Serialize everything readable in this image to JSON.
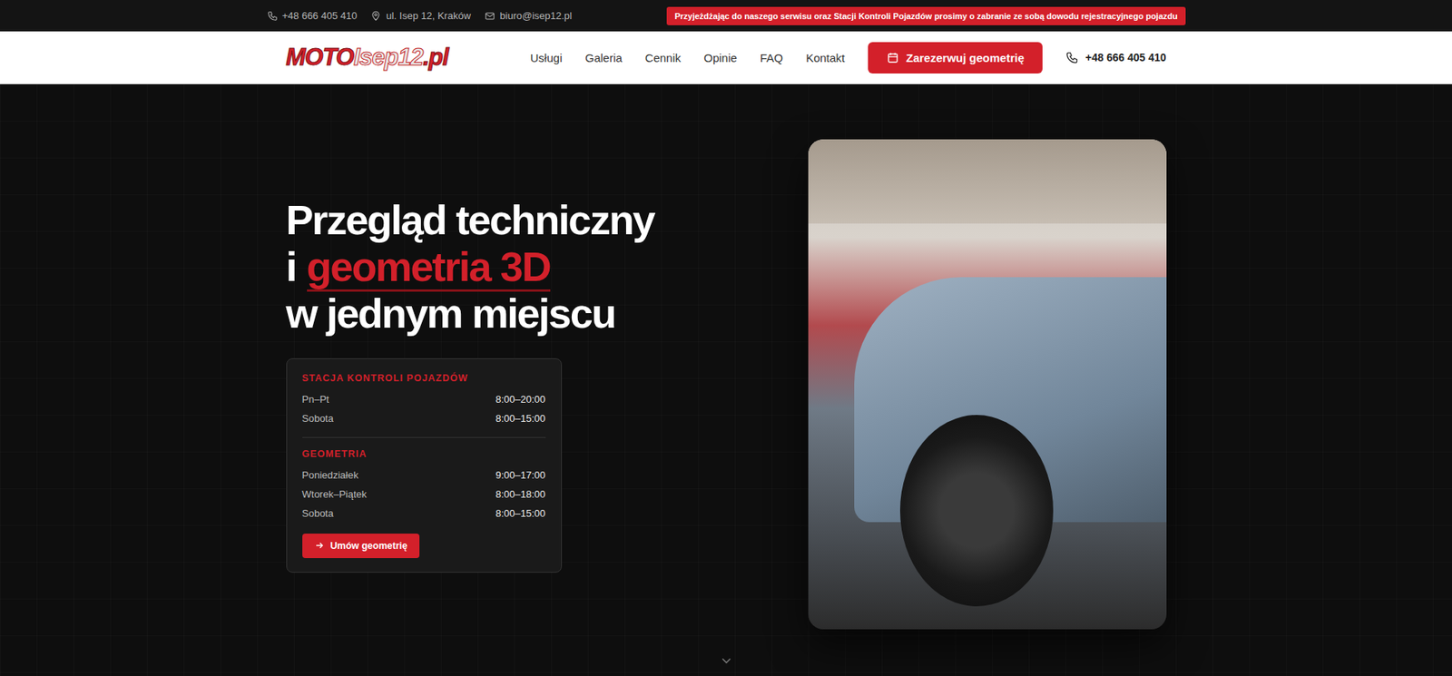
{
  "topbar": {
    "phone": "+48 666 405 410",
    "address": "ul. Isep 12, Kraków",
    "email": "biuro@isep12.pl",
    "notice": "Przyjeżdżając do naszego serwisu oraz Stacji Kontroli Pojazdów prosimy o zabranie ze sobą dowodu rejestracyjnego pojazdu"
  },
  "nav": {
    "logo": [
      "MOTO",
      "Isep12",
      ".pl"
    ],
    "links": [
      "Usługi",
      "Galeria",
      "Cennik",
      "Opinie",
      "FAQ",
      "Kontakt"
    ],
    "cta": "Zarezerwuj geometrię",
    "phone": "+48 666 405 410"
  },
  "hero": {
    "title": {
      "line1": "Przegląd techniczny",
      "prefix": "i",
      "highlight": "geometria 3D",
      "line3": "w jednym miejscu"
    },
    "hours": [
      {
        "title": "STACJA KONTROLI POJAZDÓW",
        "rows": [
          {
            "day": "Pn–Pt",
            "time": "8:00–20:00"
          },
          {
            "day": "Sobota",
            "time": "8:00–15:00"
          }
        ]
      },
      {
        "title": "GEOMETRIA",
        "rows": [
          {
            "day": "Poniedziałek",
            "time": "9:00–17:00"
          },
          {
            "day": "Wtorek–Piątek",
            "time": "8:00–18:00"
          },
          {
            "day": "Sobota",
            "time": "8:00–15:00"
          }
        ]
      }
    ],
    "button": "Umów geometrię"
  }
}
